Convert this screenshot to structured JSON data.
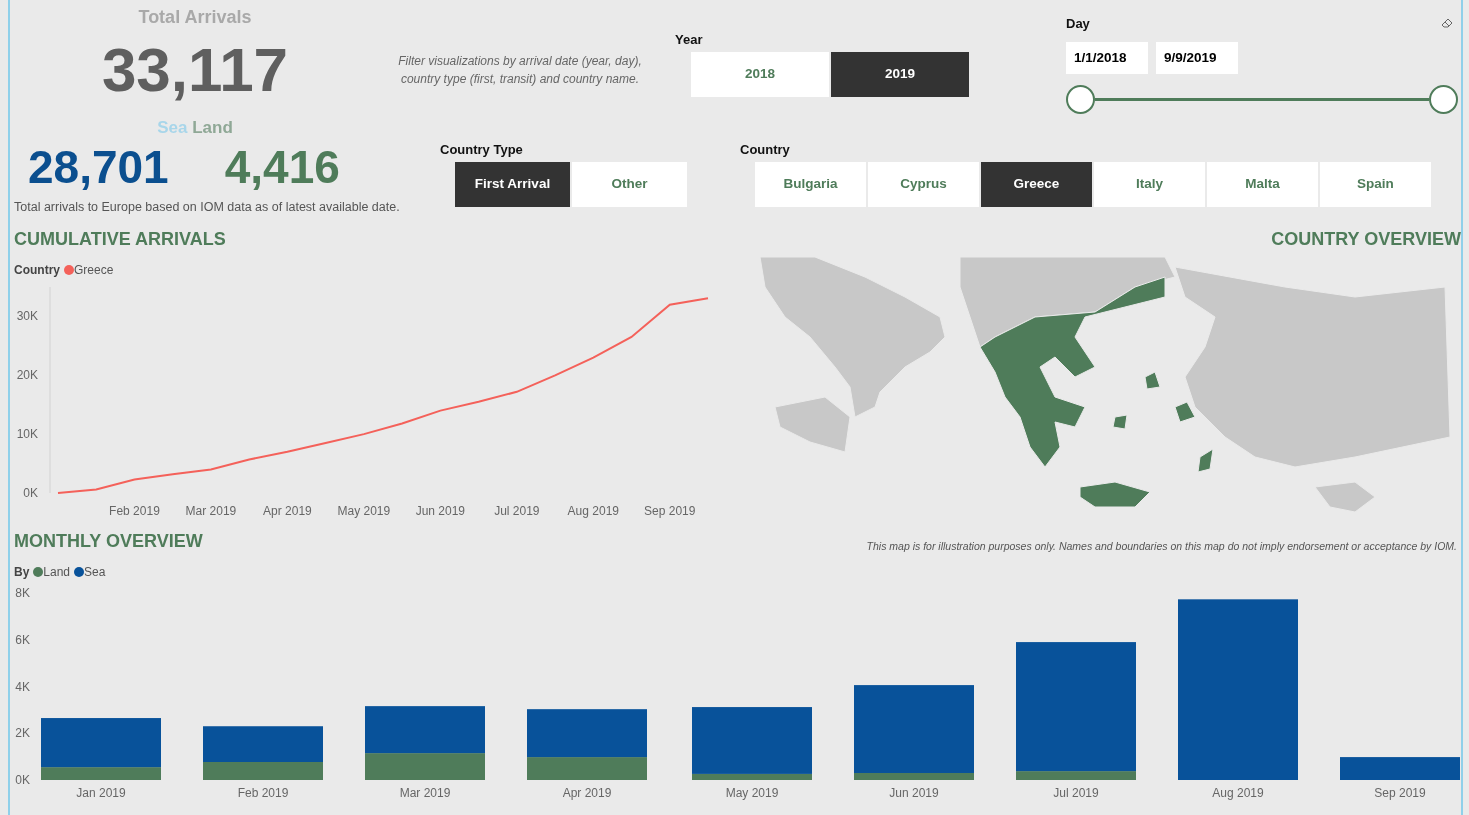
{
  "header": {
    "title": "Total Arrivals",
    "total": "33,117",
    "sea_label": "Sea",
    "land_label": "Land",
    "sea_total": "28,701",
    "land_total": "4,416",
    "caption": "Total arrivals to Europe based on IOM data as of latest available date."
  },
  "filter_note": "Filter visualizations by arrival date (year, day), country type (first, transit) and country name.",
  "year_filter": {
    "label": "Year",
    "options": [
      {
        "label": "2018",
        "selected": false
      },
      {
        "label": "2019",
        "selected": true
      }
    ]
  },
  "day_filter": {
    "label": "Day",
    "start": "1/1/2018",
    "end": "9/9/2019",
    "handles": [
      {
        "level": 0
      },
      {
        "level": 1
      }
    ]
  },
  "country_type_filter": {
    "label": "Country Type",
    "options": [
      {
        "label": "First Arrival",
        "selected": true
      },
      {
        "label": "Other",
        "selected": false
      }
    ]
  },
  "country_filter": {
    "label": "Country",
    "options": [
      {
        "label": "Bulgaria",
        "selected": false
      },
      {
        "label": "Cyprus",
        "selected": false
      },
      {
        "label": "Greece",
        "selected": true
      },
      {
        "label": "Italy",
        "selected": false
      },
      {
        "label": "Malta",
        "selected": false
      },
      {
        "label": "Spain",
        "selected": false
      }
    ]
  },
  "cumulative_arrivals": {
    "title": "CUMULATIVE ARRIVALS",
    "legend_title": "Country",
    "chart_data": {
      "type": "line",
      "categories": [
        null,
        null,
        "Feb 2019",
        null,
        "Mar 2019",
        null,
        "Apr 2019",
        null,
        "May 2019",
        null,
        "Jun 2019",
        null,
        "Jul 2019",
        null,
        "Aug 2019",
        null,
        "Sep 2019",
        null
      ],
      "series": [
        {
          "name": "Greece",
          "color": "#f4615a",
          "values": [
            0,
            600,
            2300,
            3200,
            4000,
            5700,
            7000,
            8500,
            10000,
            11800,
            14000,
            15500,
            17200,
            20000,
            23000,
            26500,
            32000,
            33100
          ]
        }
      ],
      "ylim": [
        0,
        35000
      ],
      "yticks": [
        {
          "value": 0,
          "label": "0K"
        },
        {
          "value": 10000,
          "label": "10K"
        },
        {
          "value": 20000,
          "label": "20K"
        },
        {
          "value": 30000,
          "label": "30K"
        }
      ]
    }
  },
  "country_overview": {
    "title": "COUNTRY OVERVIEW",
    "disclaimer": "This map is for illustration purposes only. Names and boundaries on this map do not imply endorsement or acceptance by IOM."
  },
  "monthly_overview": {
    "title": "MONTHLY OVERVIEW",
    "legend_title": "By",
    "chart_data": {
      "type": "bar",
      "stacked": true,
      "categories": [
        "Jan 2019",
        "Feb 2019",
        "Mar 2019",
        "Apr 2019",
        "May 2019",
        "Jun 2019",
        "Jul 2019",
        "Aug 2019",
        "Sep 2019"
      ],
      "series": [
        {
          "name": "Land",
          "color": "#4f7c5a",
          "values": [
            550,
            770,
            1150,
            980,
            260,
            300,
            380,
            0,
            0
          ]
        },
        {
          "name": "Sea",
          "color": "#08529a",
          "values": [
            2100,
            1530,
            2010,
            2050,
            2860,
            3760,
            5520,
            7730,
            980
          ]
        }
      ],
      "ylim": [
        0,
        8000
      ],
      "yticks": [
        {
          "value": 0,
          "label": "0K"
        },
        {
          "value": 2000,
          "label": "2K"
        },
        {
          "value": 4000,
          "label": "4K"
        },
        {
          "value": 6000,
          "label": "6K"
        },
        {
          "value": 8000,
          "label": "8K"
        }
      ]
    }
  }
}
